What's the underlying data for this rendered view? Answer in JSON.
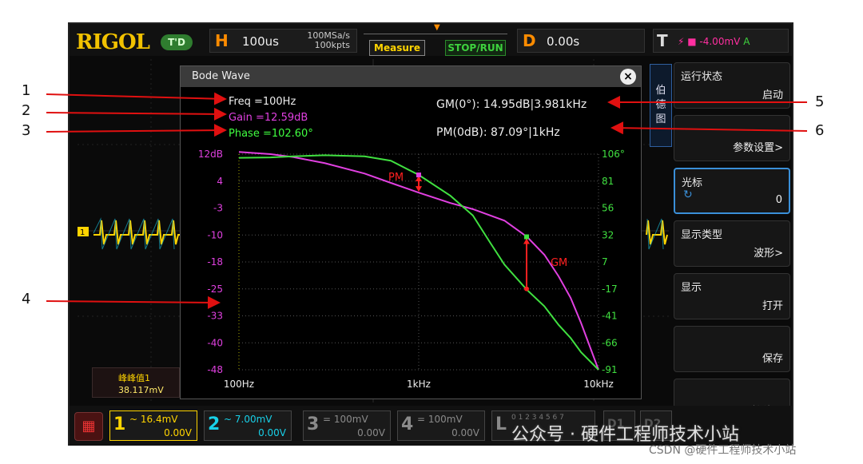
{
  "topbar": {
    "logo": "RIGOL",
    "mode_badge": "T'D",
    "horizontal": {
      "letter": "H",
      "timebase": "100us",
      "sample_rate": "100MSa/s",
      "memory_depth": "100kpts"
    },
    "measure_button": "Measure",
    "run_button": "STOP/RUN",
    "delay": {
      "letter": "D",
      "value": "0.00s"
    },
    "trigger": {
      "letter": "T",
      "level": "-4.00mV",
      "source": "A"
    }
  },
  "measurement": {
    "label": "峰峰值1",
    "value": "38.117mV"
  },
  "bode": {
    "title": "Bode Wave",
    "close_label": "×",
    "freq": "Freq =100Hz",
    "gain": "Gain =12.59dB",
    "phase": "Phase =102.60°",
    "gm": "GM(0°):  14.95dB|3.981kHz",
    "pm": "PM(0dB): 87.09°|1kHz",
    "pm_marker": "PM",
    "gm_marker": "GM",
    "colors": {
      "gain": "#e040e0",
      "phase": "#40e040",
      "marker": "#ff2020"
    }
  },
  "chart_data": {
    "type": "line",
    "xscale": "log",
    "xlim": [
      100,
      10000
    ],
    "x_ticks": [
      "100Hz",
      "1kHz",
      "10kHz"
    ],
    "ylabel_left_ticks": [
      "12dB",
      "4",
      "-3",
      "-10",
      "-18",
      "-25",
      "-33",
      "-40",
      "-48"
    ],
    "ylabel_right_ticks": [
      "106°",
      "81",
      "56",
      "32",
      "7",
      "-17",
      "-41",
      "-66",
      "-91"
    ],
    "ylim_left": [
      -48,
      12
    ],
    "ylim_right": [
      -91,
      106
    ],
    "series": [
      {
        "x": [
          100,
          150,
          200,
          300,
          500,
          700,
          1000,
          1500,
          2000,
          3000,
          4000,
          5000,
          6000,
          7000,
          8000,
          10000
        ],
        "y": [
          12.6,
          12,
          11.2,
          9.5,
          6.6,
          4,
          1.3,
          -1.6,
          -3.3,
          -6.5,
          -11,
          -16,
          -22,
          -28,
          -35,
          -48
        ]
      },
      {
        "x": [
          100,
          150,
          200,
          300,
          500,
          700,
          1000,
          1500,
          2000,
          2500,
          3000,
          4000,
          5000,
          6000,
          7000,
          8000,
          10000
        ],
        "y": [
          102.6,
          103,
          104,
          105,
          104,
          100,
          87,
          68,
          50,
          25,
          5,
          -18,
          -33,
          -50,
          -62,
          -75,
          -91
        ]
      }
    ]
  },
  "menu": {
    "tag": [
      "伯",
      "德",
      "图"
    ],
    "items": [
      {
        "title": "运行状态",
        "value": "启动"
      },
      {
        "title": "",
        "value": "参数设置>"
      },
      {
        "title": "光标",
        "value": "0"
      },
      {
        "title": "显示类型",
        "value": "波形>"
      },
      {
        "title": "显示",
        "value": "打开"
      },
      {
        "title": "",
        "value": "保存"
      },
      {
        "title": "",
        "value": "接线图"
      }
    ]
  },
  "channels": [
    {
      "num": "1",
      "scale": "~ 16.4mV",
      "offset": "0.00V"
    },
    {
      "num": "2",
      "scale": "~ 7.00mV",
      "offset": "0.00V"
    },
    {
      "num": "3",
      "scale": "= 100mV",
      "offset": "0.00V"
    },
    {
      "num": "4",
      "scale": "= 100mV",
      "offset": "0.00V"
    },
    {
      "num": "L",
      "scale": "0 1 2 3  4 5 6 7",
      "offset": ""
    },
    {
      "num": "D1",
      "scale": "",
      "offset": ""
    },
    {
      "num": "D2",
      "scale": "",
      "offset": ""
    }
  ],
  "annotations": [
    "1",
    "2",
    "3",
    "4",
    "5",
    "6"
  ],
  "watermark": "公众号 · 硬件工程师技术小站",
  "credit": "CSDN @硬件工程师技术小站"
}
